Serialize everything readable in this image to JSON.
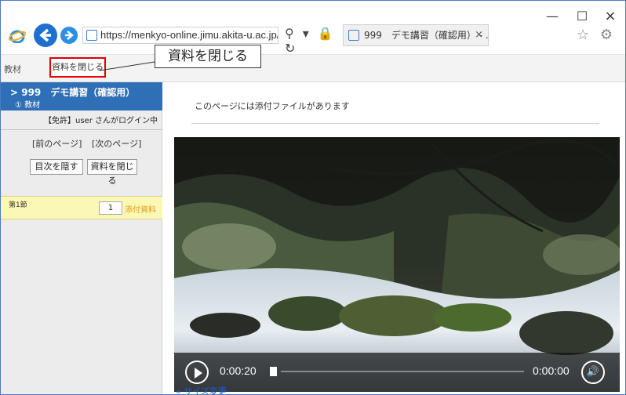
{
  "window": {
    "minimize": "—",
    "maximize": "☐",
    "close": "×"
  },
  "address_bar": {
    "url": "https://menkyo-online.jimu.akita-u.ac.jp/webcl",
    "icons": "⚲ ▾ 🔒 ↻"
  },
  "browser_tab": {
    "title": "999　デモ講習（確認用） - ...",
    "close": "×"
  },
  "browser_icons": "☆ ⚙",
  "toolbar": {
    "materials_tab": "教材",
    "close_materials_button": "資料を閉じる"
  },
  "callout": {
    "text": "資料を閉じる"
  },
  "sidebar": {
    "course_title": "> 999　デモ講習（確認用）",
    "course_subtitle": "① 教材",
    "login_status": "【免許】user さんがログイン中",
    "prev_page": "[前のページ]",
    "next_page": "[次のページ]",
    "hide_toc_button": "目次を隠す",
    "close_materials_button": "資料を閉じる",
    "section_label": "第1節",
    "page_number": "1",
    "attachment_link": "添付資料"
  },
  "content": {
    "attachment_notice": "このページには添付ファイルがあります",
    "resize_link": "» サイズ変更"
  },
  "video": {
    "current_time": "0:00:20",
    "duration": "0:00:00",
    "volume_icon": "🔊"
  }
}
